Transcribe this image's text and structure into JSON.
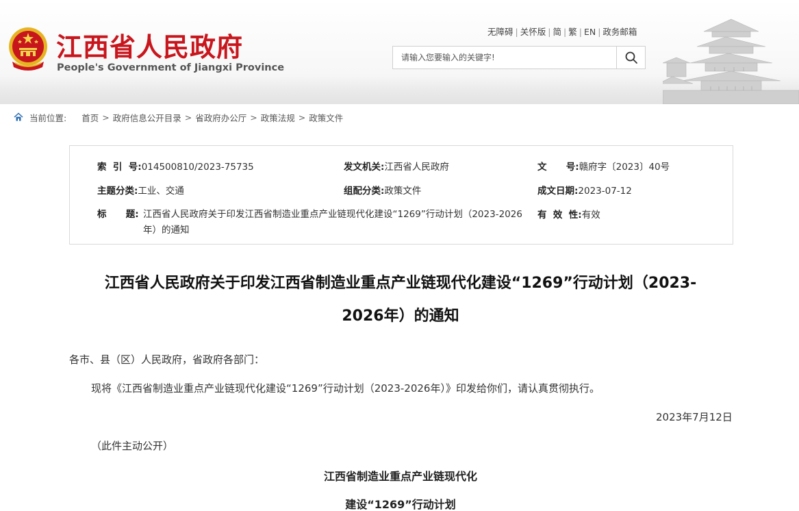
{
  "header": {
    "site_title": "江西省人民政府",
    "site_subtitle": "People's Government of Jiangxi Province",
    "links": [
      "无障碍",
      "关怀版",
      "简",
      "繁",
      "EN",
      "政务邮箱"
    ],
    "search_placeholder": "请输入您要输入的关键字!",
    "colors": {
      "brand_red": "#c8161d",
      "emblem_gold": "#e6b422"
    }
  },
  "breadcrumb": {
    "label": "当前位置:",
    "items": [
      "首页",
      "政府信息公开目录",
      "省政府办公厅",
      "政策法规",
      "政策文件"
    ]
  },
  "meta": {
    "index_key": "索  引  号:",
    "index_val": "014500810/2023-75735",
    "issuer_key": "发文机关:",
    "issuer_val": "江西省人民政府",
    "docno_key": "文      号:",
    "docno_val": "赣府字〔2023〕40号",
    "subject_key": "主题分类:",
    "subject_val": "工业、交通",
    "category_key": "组配分类:",
    "category_val": "政策文件",
    "date_key": "成文日期:",
    "date_val": "2023-07-12",
    "title_key": "标      题:",
    "title_val": "江西省人民政府关于印发江西省制造业重点产业链现代化建设“1269”行动计划（2023-2026年）的通知",
    "validity_key": "有  效  性:",
    "validity_val": "有效"
  },
  "article": {
    "title_line1": "江西省人民政府关于印发江西省制造业重点产业链现代化建设“1269”行动计划（2023-",
    "title_line2": "2026年）的通知",
    "salutation": "各市、县（区）人民政府，省政府各部门：",
    "body": "现将《江西省制造业重点产业链现代化建设“1269”行动计划（2023-2026年）》印发给你们，请认真贯彻执行。",
    "date": "2023年7月12日",
    "note": "（此件主动公开）",
    "sub_title_line1": "江西省制造业重点产业链现代化",
    "sub_title_line2": "建设“1269”行动计划"
  }
}
